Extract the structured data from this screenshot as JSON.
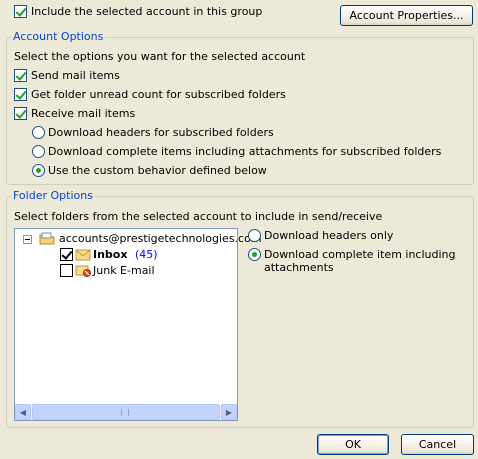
{
  "top": {
    "include_label": "Include the selected account in this group",
    "include_checked": true,
    "account_properties_button": "Account Properties..."
  },
  "account_options": {
    "legend": "Account Options",
    "description": "Select the options you want for the selected account",
    "send_mail": {
      "label": "Send mail items",
      "checked": true
    },
    "folder_unread": {
      "label": "Get folder unread count for subscribed folders",
      "checked": true
    },
    "receive_mail": {
      "label": "Receive mail items",
      "checked": true
    },
    "radios": [
      {
        "label": "Download headers for subscribed folders",
        "selected": false
      },
      {
        "label": "Download complete items including attachments for subscribed folders",
        "selected": false
      },
      {
        "label": "Use the custom behavior defined below",
        "selected": true
      }
    ]
  },
  "folder_options": {
    "legend": "Folder Options",
    "description": "Select folders from the selected account to include in send/receive",
    "tree": {
      "account": "accounts@prestigetechnologies.com",
      "inbox": {
        "label": "Inbox",
        "count": "(45)",
        "checked": true
      },
      "junk": {
        "label": "Junk E-mail",
        "checked": false
      }
    },
    "radios": [
      {
        "label": "Download headers only",
        "selected": false
      },
      {
        "label_line1": "Download complete item including",
        "label_line2": "attachments",
        "selected": true
      }
    ]
  },
  "footer": {
    "ok": "OK",
    "cancel": "Cancel"
  }
}
